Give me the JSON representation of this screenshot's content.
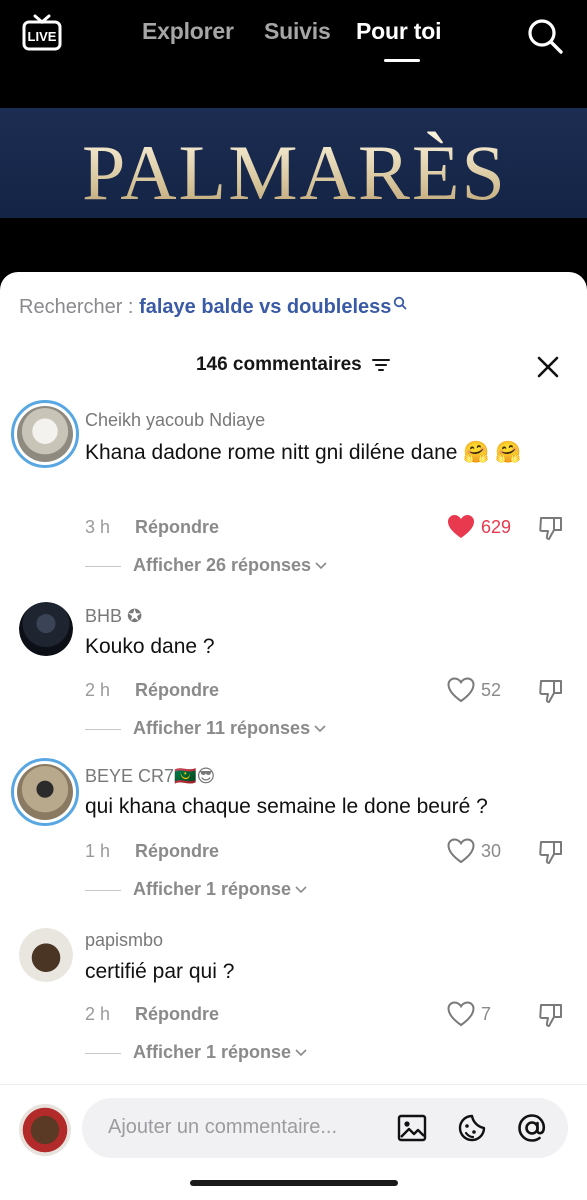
{
  "topbar": {
    "live_label": "LIVE",
    "tabs": [
      {
        "label": "Explorer",
        "active": false
      },
      {
        "label": "Suivis",
        "active": false
      },
      {
        "label": "Pour toi",
        "active": true
      }
    ]
  },
  "banner": {
    "text": "PALMARÈS"
  },
  "sheet": {
    "search_label": "Rechercher : ",
    "search_query": "falaye balde vs doubleless",
    "comment_count": "146 commentaires"
  },
  "comments": [
    {
      "username": "Cheikh yacoub Ndiaye",
      "text": "Khana dadone rome nitt gni diléne dane 🤗 🤗",
      "time": "3 h",
      "reply_label": "Répondre",
      "likes": "629",
      "liked": true,
      "replies": "Afficher 26 réponses"
    },
    {
      "username": "BHB ✪",
      "text": "Kouko dane ?",
      "time": "2 h",
      "reply_label": "Répondre",
      "likes": "52",
      "liked": false,
      "replies": "Afficher 11 réponses"
    },
    {
      "username": "BEYE CR7🇲🇷😎",
      "text": "qui khana chaque semaine le done beuré ?",
      "time": "1 h",
      "reply_label": "Répondre",
      "likes": "30",
      "liked": false,
      "replies": "Afficher 1 réponse"
    },
    {
      "username": "papismbo",
      "text": "certifié par qui ?",
      "time": "2 h",
      "reply_label": "Répondre",
      "likes": "7",
      "liked": false,
      "replies": "Afficher 1 réponse"
    }
  ],
  "composer": {
    "placeholder": "Ajouter un commentaire..."
  },
  "colors": {
    "like_red": "#e8394e",
    "link_blue": "#3a5aa6",
    "story_ring": "#58a7e2"
  }
}
